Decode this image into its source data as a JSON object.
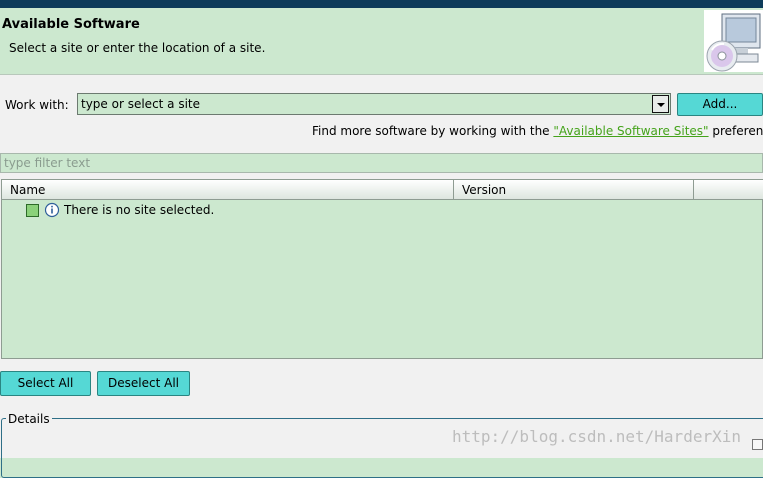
{
  "header": {
    "title": "Available Software",
    "subtitle": "Select a site or enter the location of a site."
  },
  "work_with": {
    "label": "Work with:",
    "value": "type or select a site",
    "add_button": "Add..."
  },
  "more_software": {
    "text_prefix": "Find more software by working with the ",
    "link_text": "\"Available Software Sites\"",
    "text_suffix": " preferences"
  },
  "filter": {
    "placeholder": "type filter text"
  },
  "table": {
    "columns": [
      "Name",
      "Version",
      ""
    ],
    "rows": [
      {
        "text": "There is no site selected."
      }
    ]
  },
  "buttons": {
    "select_all": "Select All",
    "deselect_all": "Deselect All"
  },
  "details": {
    "label": "Details"
  },
  "watermark": "http://blog.csdn.net/HarderXin",
  "colors": {
    "background": "#cce8cf",
    "button": "#55d8d5",
    "link": "#45a31b",
    "topbar": "#0d3b5a"
  }
}
